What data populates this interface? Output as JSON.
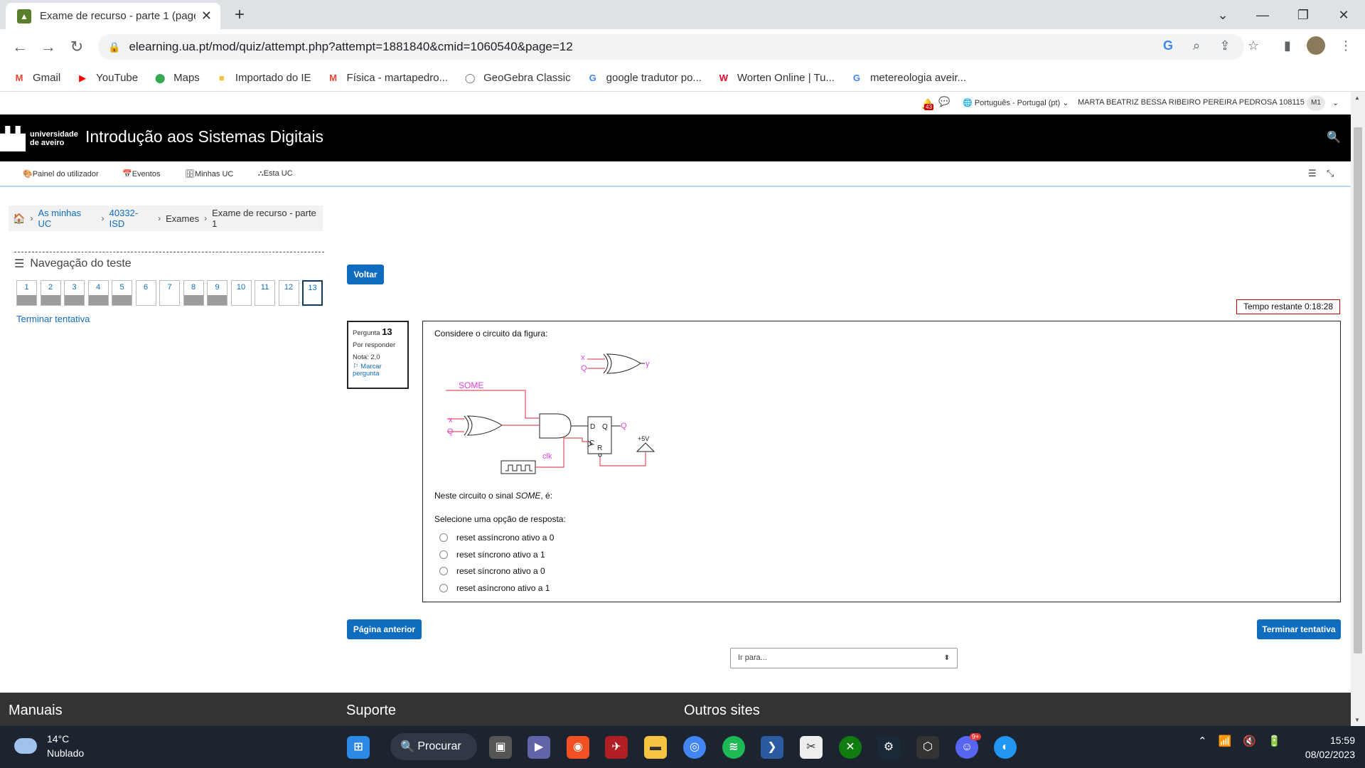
{
  "browser": {
    "tab_title": "Exame de recurso - parte 1 (page",
    "url": "elearning.ua.pt/mod/quiz/attempt.php?attempt=1881840&cmid=1060540&page=12",
    "bookmarks": [
      {
        "label": "Gmail",
        "icon": "gmail-icon",
        "color": "#ea4335",
        "glyph": "M"
      },
      {
        "label": "YouTube",
        "icon": "youtube-icon",
        "color": "#ff0000",
        "glyph": "▶"
      },
      {
        "label": "Maps",
        "icon": "maps-icon",
        "color": "#34a853",
        "glyph": "⬤"
      },
      {
        "label": "Importado do IE",
        "icon": "folder-icon",
        "color": "#f6c343",
        "glyph": "■"
      },
      {
        "label": "Física - martapedro...",
        "icon": "gmail-icon",
        "color": "#ea4335",
        "glyph": "M"
      },
      {
        "label": "GeoGebra Classic",
        "icon": "geogebra-icon",
        "color": "#666666",
        "glyph": "◯"
      },
      {
        "label": "google tradutor po...",
        "icon": "google-icon",
        "color": "#4285f4",
        "glyph": "G"
      },
      {
        "label": "Worten Online | Tu...",
        "icon": "worten-icon",
        "color": "#e4002b",
        "glyph": "W"
      },
      {
        "label": "metereologia aveir...",
        "icon": "google-icon",
        "color": "#4285f4",
        "glyph": "G"
      }
    ]
  },
  "userbar": {
    "notif_count": "43",
    "language": "Português - Portugal (pt)",
    "user_name": "MARTA BEATRIZ BESSA RIBEIRO PEREIRA PEDROSA 108115",
    "avatar": "M1"
  },
  "header": {
    "logo_line1": "universidade",
    "logo_line2": "de aveiro",
    "course_title": "Introdução aos Sistemas Digitais"
  },
  "nav": [
    "Painel do utilizador",
    "Eventos",
    "Minhas UC",
    "Esta UC"
  ],
  "breadcrumb": [
    "As minhas UC",
    "40332-ISD",
    "Exames",
    "Exame de recurso - parte 1"
  ],
  "quiz_nav": {
    "title": "Navegação do teste",
    "questions": [
      {
        "n": "1",
        "answered": true
      },
      {
        "n": "2",
        "answered": true
      },
      {
        "n": "3",
        "answered": true
      },
      {
        "n": "4",
        "answered": true
      },
      {
        "n": "5",
        "answered": true
      },
      {
        "n": "6",
        "answered": false
      },
      {
        "n": "7",
        "answered": false
      },
      {
        "n": "8",
        "answered": true
      },
      {
        "n": "9",
        "answered": true
      },
      {
        "n": "10",
        "answered": false
      },
      {
        "n": "11",
        "answered": false
      },
      {
        "n": "12",
        "answered": false
      },
      {
        "n": "13",
        "answered": false,
        "current": true
      }
    ],
    "finish_link": "Terminar tentativa"
  },
  "buttons": {
    "back": "Voltar",
    "prev_page": "Página anterior",
    "finish": "Terminar tentativa"
  },
  "timer": "Tempo restante 0:18:28",
  "question": {
    "label": "Pergunta",
    "number": "13",
    "status": "Por responder",
    "grade": "Nota: 2,0",
    "flag_line1": "Marcar",
    "flag_line2": "pergunta",
    "intro": "Considere o circuito da figura:",
    "stem_prefix": "Neste circuito o sinal ",
    "stem_signal": "SOME",
    "stem_suffix": ", é:",
    "select_prompt": "Selecione uma opção de resposta:",
    "options": [
      "reset assíncrono ativo a 0",
      "reset síncrono ativo a 1",
      "reset síncrono ativo a 0",
      "reset asíncrono ativo a 1"
    ],
    "circuit_labels": {
      "x": "x",
      "q": "Q",
      "y": "y",
      "some": "SOME",
      "clk": "clk",
      "d": "D",
      "c": "C",
      "r": "R",
      "qout": "Q",
      "vcc": "+5V"
    }
  },
  "goto_select": "Ir para...",
  "footer": [
    "Manuais",
    "Suporte",
    "Outros sites"
  ],
  "taskbar": {
    "temp": "14°C",
    "condition": "Nublado",
    "search": "Procurar",
    "time": "15:59",
    "date": "08/02/2023",
    "discord_badge": "9+"
  },
  "colors": {
    "accent": "#0f6cbf",
    "header_bg": "#000000",
    "circuit_label": "#e040e0",
    "circuit_wire": "#e05060"
  }
}
